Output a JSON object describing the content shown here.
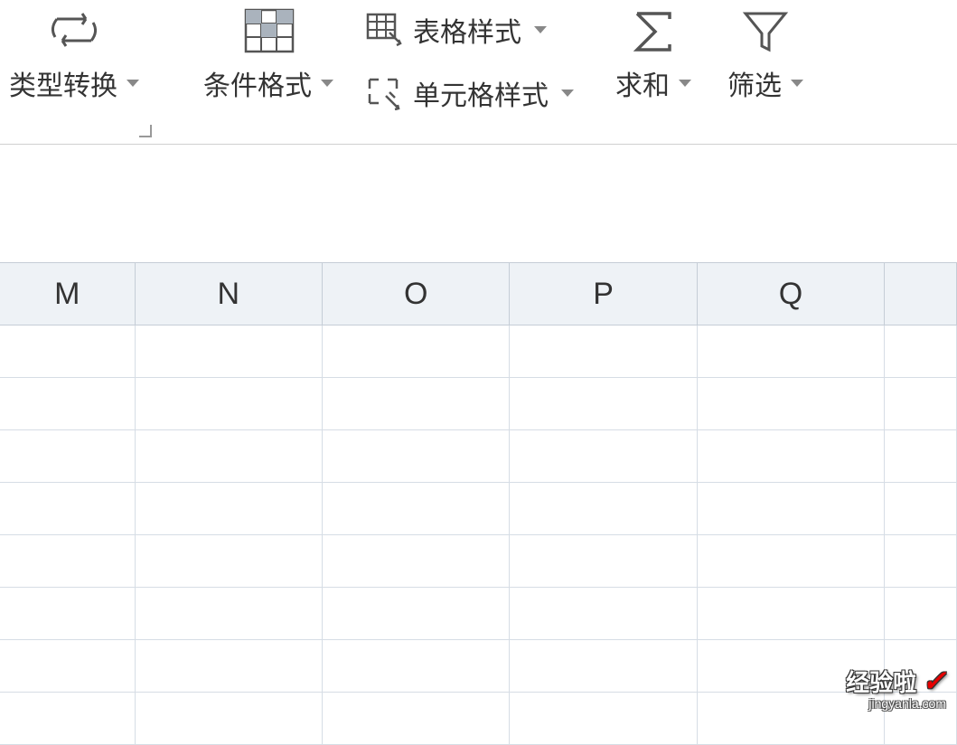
{
  "ribbon": {
    "type_convert": "类型转换",
    "conditional_format": "条件格式",
    "table_style": "表格样式",
    "cell_style": "单元格样式",
    "sum": "求和",
    "filter": "筛选"
  },
  "columns": [
    "M",
    "N",
    "O",
    "P",
    "Q",
    ""
  ],
  "watermark": {
    "main": "经验啦",
    "sub": "jingyanla.com"
  }
}
